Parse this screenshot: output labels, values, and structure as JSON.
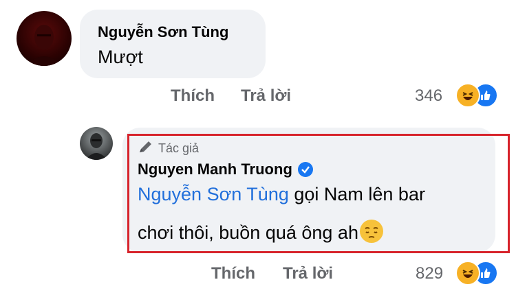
{
  "comment1": {
    "author": "Nguyễn Sơn Tùng",
    "text": "Mượt",
    "like_label": "Thích",
    "reply_label": "Trả lời",
    "reaction_count": "346",
    "reactions": [
      "haha-icon",
      "like-icon"
    ]
  },
  "comment2": {
    "badge": "Tác giả",
    "author": "Nguyen Manh Truong",
    "verified": true,
    "mention": "Nguyễn Sơn Tùng",
    "line1_rest": " gọi Nam lên bar",
    "line2": "chơi thôi, buồn quá ông ah",
    "like_label": "Thích",
    "reply_label": "Trả lời",
    "reaction_count": "829",
    "reactions": [
      "haha-icon",
      "like-icon"
    ]
  },
  "colors": {
    "bubble": "#f0f2f5",
    "mention": "#216fdb",
    "highlight_border": "#d7242c",
    "like_blue": "#1877f2",
    "haha_yellow": "#f7b125",
    "muted_text": "#65676b"
  }
}
